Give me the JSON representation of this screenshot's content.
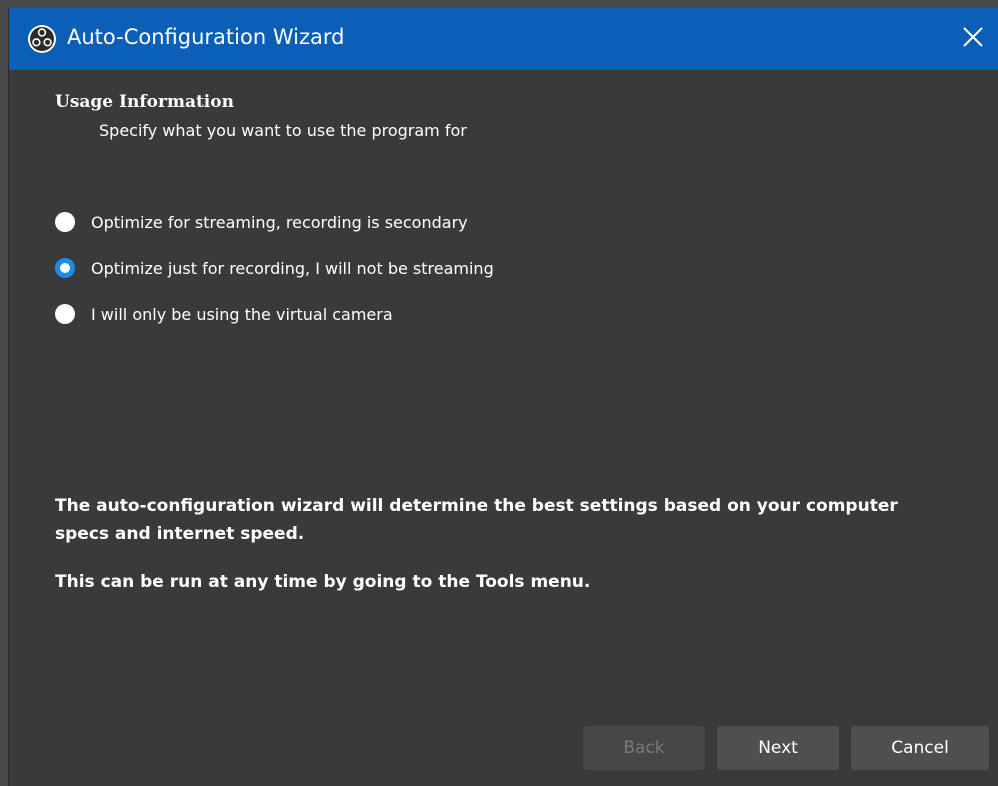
{
  "window": {
    "title": "Auto-Configuration Wizard",
    "icon": "obs-logo-icon",
    "close_icon": "close-icon"
  },
  "section": {
    "title": "Usage Information",
    "subtitle": "Specify what you want to use the program for"
  },
  "options": [
    {
      "label": "Optimize for streaming, recording is secondary",
      "checked": false
    },
    {
      "label": "Optimize just for recording, I will not be streaming",
      "checked": true
    },
    {
      "label": "I will only be using the virtual camera",
      "checked": false
    }
  ],
  "info": {
    "line1": "The auto-configuration wizard will determine the best settings based on your computer specs and internet speed.",
    "line2": "This can be run at any time by going to the Tools menu."
  },
  "buttons": {
    "back": "Back",
    "next": "Next",
    "cancel": "Cancel"
  },
  "colors": {
    "titlebar": "#0b5fb6",
    "background": "#3a3a3a",
    "accent": "#1f8be8"
  }
}
